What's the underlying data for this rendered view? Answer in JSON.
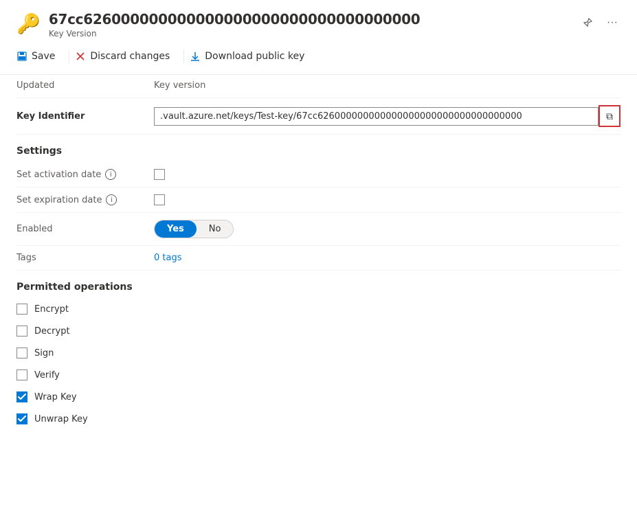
{
  "header": {
    "key_icon": "🔑",
    "title": "67cc626000000000000000000000000000000000",
    "subtitle": "Key Version",
    "pin_icon": "📌",
    "more_icon": "…"
  },
  "toolbar": {
    "save_label": "Save",
    "discard_label": "Discard changes",
    "download_label": "Download public key"
  },
  "fields": {
    "updated_label": "Updated",
    "updated_value": "Key version",
    "key_identifier_label": "Key Identifier",
    "key_identifier_value": ".vault.azure.net/keys/Test-key/67cc626000000000000000000000000000000000"
  },
  "settings": {
    "heading": "Settings",
    "activation_date_label": "Set activation date",
    "activation_date_checked": false,
    "expiration_date_label": "Set expiration date",
    "expiration_date_checked": false,
    "enabled_label": "Enabled",
    "enabled_yes": "Yes",
    "enabled_no": "No",
    "tags_label": "Tags",
    "tags_value": "0 tags"
  },
  "permitted_operations": {
    "heading": "Permitted operations",
    "operations": [
      {
        "label": "Encrypt",
        "checked": false
      },
      {
        "label": "Decrypt",
        "checked": false
      },
      {
        "label": "Sign",
        "checked": false
      },
      {
        "label": "Verify",
        "checked": false
      },
      {
        "label": "Wrap Key",
        "checked": true
      },
      {
        "label": "Unwrap Key",
        "checked": true
      }
    ]
  },
  "icons": {
    "save": "💾",
    "discard": "✕",
    "download": "↓",
    "copy": "⧉",
    "info": "i",
    "pin": "🖈",
    "more": "···"
  }
}
